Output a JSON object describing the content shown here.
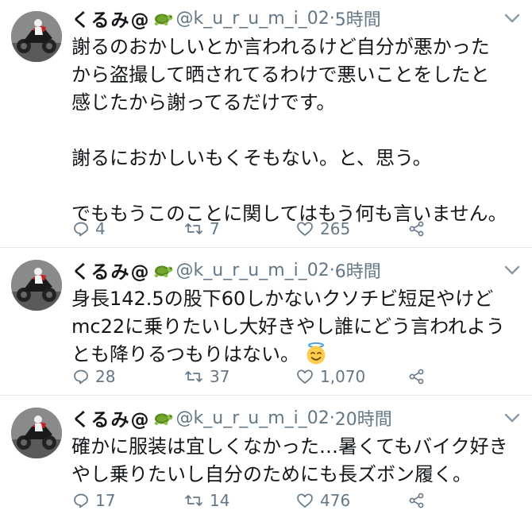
{
  "tweets": [
    {
      "name": "くるみ@",
      "handle": "@k_u_r_u_m_i_02",
      "dot": "·",
      "time": "5時間",
      "lines": [
        "謝るのおかしいとか言われるけど自分が悪かった",
        "から盗撮して晒されてるわけで悪いことをしたと",
        "感じたから謝ってるだけです。",
        "",
        "謝るにおかしいもくそもない。と、思う。",
        "",
        "でももうこのことに関してはもう何も言いません。"
      ],
      "replies": "4",
      "retweets": "7",
      "likes": "265"
    },
    {
      "name": "くるみ@",
      "handle": "@k_u_r_u_m_i_02",
      "dot": "·",
      "time": "6時間",
      "lines": [
        "身長142.5の股下60しかないクソチビ短足やけど",
        "mc22に乗りたいし大好きやし誰にどう言われよう",
        "とも降りるつもりはない。"
      ],
      "emoji": "smiling-face-with-halo",
      "replies": "28",
      "retweets": "37",
      "likes": "1,070"
    },
    {
      "name": "くるみ@",
      "handle": "@k_u_r_u_m_i_02",
      "dot": "·",
      "time": "20時間",
      "lines": [
        "確かに服装は宜しくなかった…暑くてもバイク好き",
        "やし乗りたいし自分のためにも長ズボン履く。"
      ],
      "replies": "17",
      "retweets": "14",
      "likes": "476"
    }
  ],
  "icons": {
    "name_emoji": "turtle-icon",
    "reply": "reply-icon",
    "retweet": "retweet-icon",
    "like": "heart-icon",
    "share": "share-icon",
    "menu": "chevron-down-icon"
  },
  "colors": {
    "text": "#14171a",
    "secondary": "#657786",
    "divider": "#e1e8ed"
  }
}
